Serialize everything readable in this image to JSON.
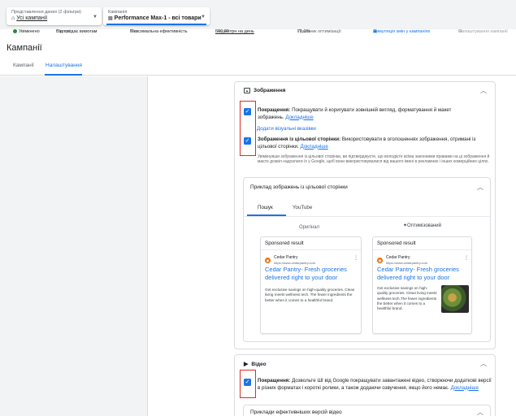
{
  "topbar": {
    "view_selector": {
      "caption": "Представлення даних (2 фільтри)",
      "value": "Усі кампанії"
    },
    "campaign_selector": {
      "caption": "Кампанія",
      "value": "Performance Max-1 - всі товари"
    }
  },
  "status_bar": {
    "state": "Увімкнено",
    "status_label": "Статус:",
    "status_value": "Відповідає вимогам",
    "type_label": "Тип:",
    "type_value": "Максимальна ефективність",
    "budget_label": "Бюджет:",
    "budget_value": "500,00 грн на день",
    "score_label": "Показник оптимізації:",
    "score_value": "71,1%",
    "simulate_link": "Симуляція змін у кампаніях",
    "settings_link": "Налаштування кампанії"
  },
  "page_title": "Кампанії",
  "tabs": [
    {
      "label": "Кампанії"
    },
    {
      "label": "Налаштування"
    }
  ],
  "images_section": {
    "title": "Зображення",
    "enhance_label": "Покращення:",
    "enhance_text": "Покращувати й коригувати зовнішній вигляд, форматування й макет зображень.",
    "enhance_link": "Докладніше",
    "visual_hints_link": "Додати візуальні вказівки",
    "landing_label": "Зображення із цільової сторінки:",
    "landing_text": "Використовувати в оголошеннях зображення, отримані із цільової сторінки.",
    "landing_link": "Докладніше",
    "disclaimer": "Увімкнувши зображення із цільової сторінки, ви підтверджуєте, що володієте всіма законними правами на ці зображення й маєте дозвіл надсилати їх у Google, щоб вони використовувалися від вашого імені в рекламних і інших комерційних цілях.",
    "example": {
      "title": "Приклад зображень із цільової сторінки",
      "tabs": [
        {
          "label": "Пошук"
        },
        {
          "label": "YouTube"
        }
      ],
      "original_label": "Оригінал",
      "optimized_label": "Оптимізований",
      "ad": {
        "sponsored": "Sponsored result",
        "name": "Cedar Pantry",
        "url": "https://www.cedarpantry.com",
        "headline": "Cedar Pantry- Fresh groceries delivered right to your door",
        "description_original": "Get exclusive savings on high-quality groceries. Clean living meets wellness tech. The fewer ingredients the better when it comes to a healthful brand.",
        "description_optimized": "Get exclusive savings on high-quality groceries. Clean living meets wellness tech.The fewer ingredients the better when it comes to a healthful brand."
      }
    }
  },
  "video_section": {
    "title": "Відео",
    "enhance_label": "Покращення:",
    "enhance_text": "Дозвольте ШІ від Google покращувати завантажені відео, створюючи додаткові версії в різних форматах і короткі ролики, а також додаючи озвучення, якщо його немає.",
    "enhance_link": "Докладніше",
    "examples_title": "Приклади ефективніших версій відео"
  },
  "icons": {
    "check": "check-icon",
    "chevron_up": "chevron-up-icon",
    "image": "image-icon",
    "video": "video-icon"
  }
}
